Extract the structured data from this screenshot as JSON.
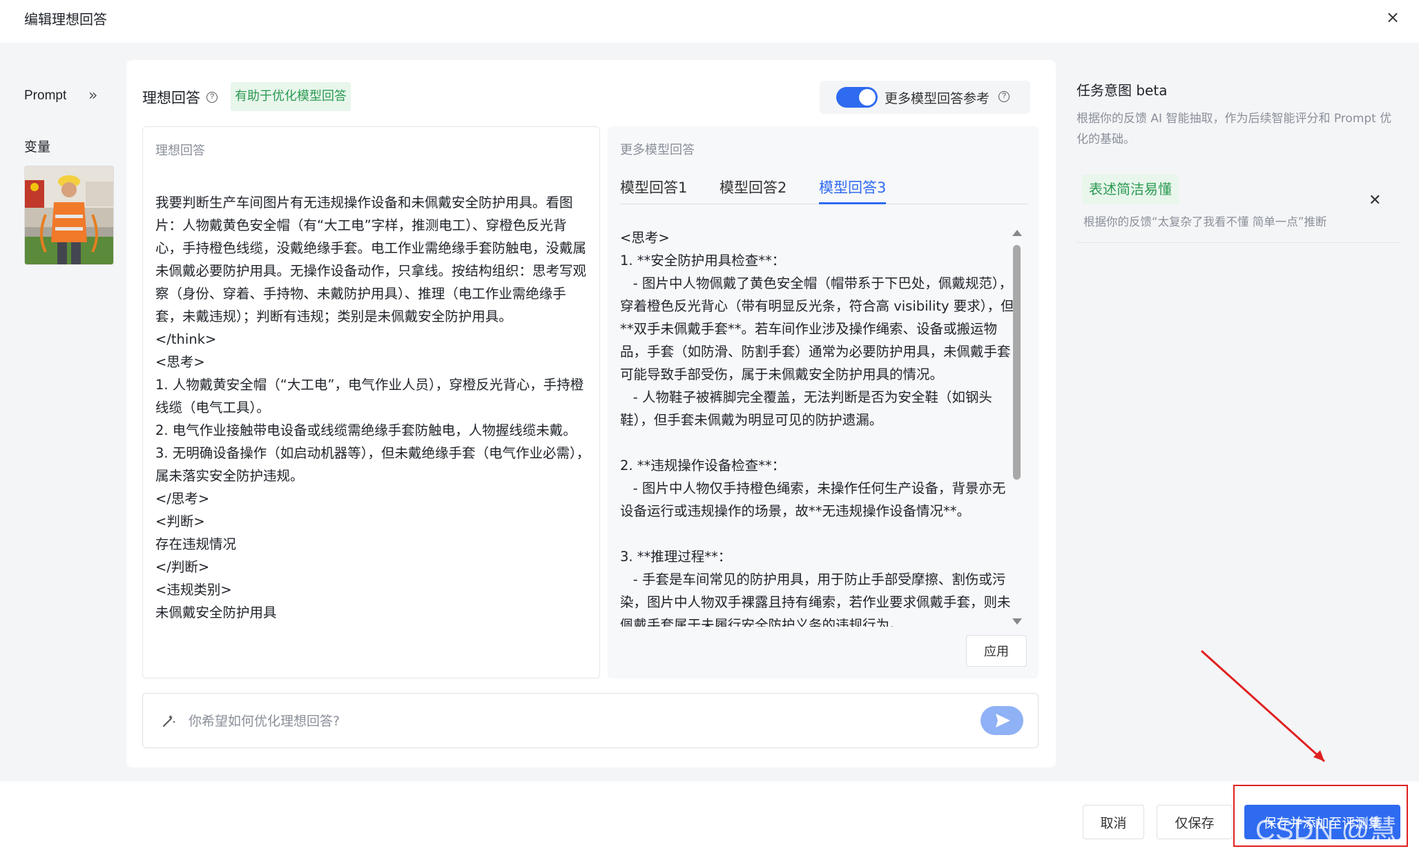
{
  "header": {
    "title": "编辑理想回答",
    "close": "×"
  },
  "sidebar": {
    "prompt_label": "Prompt",
    "expand_icon": "»",
    "variables_label": "变量"
  },
  "ideal": {
    "title": "理想回答",
    "help_icon": "?",
    "tag": "有助于优化模型回答",
    "panel_label": "理想回答",
    "text": "我要判断生产车间图片有无违规操作设备和未佩戴安全防护用具。看图片：人物戴黄色安全帽（有“大工电”字样，推测电工）、穿橙色反光背心，手持橙色线缆，没戴绝缘手套。电工作业需绝缘手套防触电，没戴属未佩戴必要防护用具。无操作设备动作，只拿线。按结构组织：思考写观察（身份、穿着、手持物、未戴防护用具）、推理（电工作业需绝缘手套，未戴违规）；判断有违规；类别是未佩戴安全防护用具。\n</think>\n<思考>\n1. 人物戴黄安全帽（“大工电”，电气作业人员），穿橙反光背心，手持橙线缆（电气工具）。\n2. 电气作业接触带电设备或线缆需绝缘手套防触电，人物握线缆未戴。\n3. 无明确设备操作（如启动机器等），但未戴绝缘手套（电气作业必需），属未落实安全防护违规。\n</思考>\n<判断>\n存在违规情况\n</判断>\n<违规类别>\n未佩戴安全防护用具"
  },
  "more_models": {
    "toggle_label": "更多模型回答参考",
    "toggle_on": true,
    "help_icon": "?",
    "panel_label": "更多模型回答",
    "tabs": [
      {
        "label": "模型回答1",
        "active": false
      },
      {
        "label": "模型回答2",
        "active": false
      },
      {
        "label": "模型回答3",
        "active": true
      }
    ],
    "text": "<思考>\n1. **安全防护用具检查**：\n   - 图片中人物佩戴了黄色安全帽（帽带系于下巴处，佩戴规范），穿着橙色反光背心（带有明显反光条，符合高 visibility 要求），但**双手未佩戴手套**。若车间作业涉及操作绳索、设备或搬运物品，手套（如防滑、防割手套）通常为必要防护用具，未佩戴手套可能导致手部受伤，属于未佩戴安全防护用具的情况。\n   - 人物鞋子被裤脚完全覆盖，无法判断是否为安全鞋（如钢头鞋），但手套未佩戴为明显可见的防护遗漏。\n\n2. **违规操作设备检查**：\n   - 图片中人物仅手持橙色绳索，未操作任何生产设备，背景亦无设备运行或违规操作的场景，故**无违规操作设备情况**。\n\n3. **推理过程**：\n   - 手套是车间常见的防护用具，用于防止手部受摩擦、割伤或污染，图片中人物双手裸露且持有绳索，若作业要求佩戴手套，则未佩戴手套属于未履行安全防护义务的违规行为。",
    "apply_label": "应用"
  },
  "input": {
    "placeholder": "你希望如何优化理想回答?"
  },
  "intent": {
    "title": "任务意图 beta",
    "desc": "根据你的反馈 AI 智能抽取，作为后续智能评分和 Prompt 优化的基础。",
    "items": [
      {
        "tag": "表述简洁易懂",
        "sub": "根据你的反馈“太复杂了我看不懂 简单一点”推断"
      }
    ]
  },
  "footer": {
    "cancel": "取消",
    "save_only": "仅保存",
    "save_add": "保存并添加至评测集",
    "watermark": "CSDN @慧斯"
  },
  "colors": {
    "primary": "#2f6bf0",
    "tag_green": "#2c9a52",
    "annotation_red": "#e02020"
  }
}
